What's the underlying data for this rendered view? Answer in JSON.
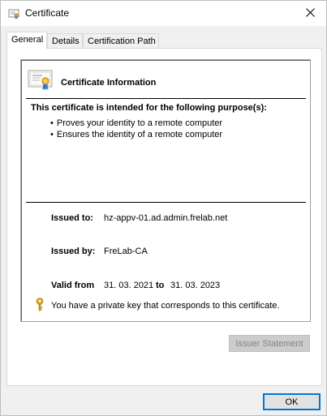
{
  "window": {
    "title": "Certificate"
  },
  "tabs": [
    {
      "label": "General"
    },
    {
      "label": "Details"
    },
    {
      "label": "Certification Path"
    }
  ],
  "info": {
    "title": "Certificate Information",
    "purpose_heading": "This certificate is intended for the following purpose(s):",
    "purposes": [
      "Proves your identity to a remote computer",
      "Ensures the identity of a remote computer"
    ],
    "issued_to_label": "Issued to:",
    "issued_to": "hz-appv-01.ad.admin.frelab.net",
    "issued_by_label": "Issued by:",
    "issued_by": "FreLab-CA",
    "valid_from_label": "Valid from",
    "valid_from": "31. 03. 2021",
    "valid_to_label": "to",
    "valid_to": "31. 03. 2023",
    "private_key_note": "You have a private key that corresponds to this certificate."
  },
  "buttons": {
    "issuer_statement": "Issuer Statement",
    "ok": "OK"
  },
  "icons": {
    "title": "certificate-icon",
    "close": "close-icon",
    "info": "certificate-icon",
    "key": "key-icon"
  },
  "colors": {
    "accent": "#0078d7",
    "disabled_button_bg": "#cccccc",
    "disabled_button_text": "#838383"
  }
}
